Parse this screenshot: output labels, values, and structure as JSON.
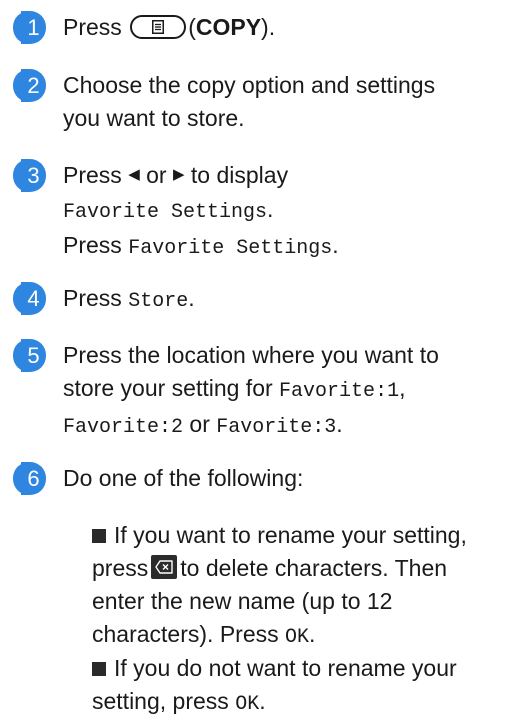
{
  "steps": [
    {
      "number": "1",
      "press": "Press",
      "copy_icon": "copy-key-icon",
      "copy_label": "COPY"
    },
    {
      "number": "2",
      "line1": "Choose the copy option and settings",
      "line2": "you want to store."
    },
    {
      "number": "3",
      "press": "Press",
      "left_arrow": "◀",
      "or": "or",
      "right_arrow": "▶",
      "to_display": "to display",
      "favorite_settings": "Favorite Settings",
      "period": ".",
      "press2": "Press",
      "favorite_settings2": "Favorite Settings"
    },
    {
      "number": "4",
      "press": "Press",
      "store": "Store"
    },
    {
      "number": "5",
      "line1": "Press the location where you want to",
      "line2_a": "store your setting for",
      "fav1": "Favorite:1",
      "fav2": "Favorite:2",
      "or": "or",
      "fav3": "Favorite:3"
    },
    {
      "number": "6",
      "line1": "Do one of the following:"
    }
  ],
  "bullets": [
    {
      "line1": "If you want to rename your setting,",
      "press": "press",
      "delete_icon": "backspace-key-icon",
      "line2_b": "to delete characters. Then",
      "line3": "enter the new name (up to 12",
      "line4_a": "characters). Press",
      "ok": "OK"
    },
    {
      "line1": "If you do not want to rename your",
      "line2_a": "setting, press",
      "ok": "OK"
    }
  ]
}
